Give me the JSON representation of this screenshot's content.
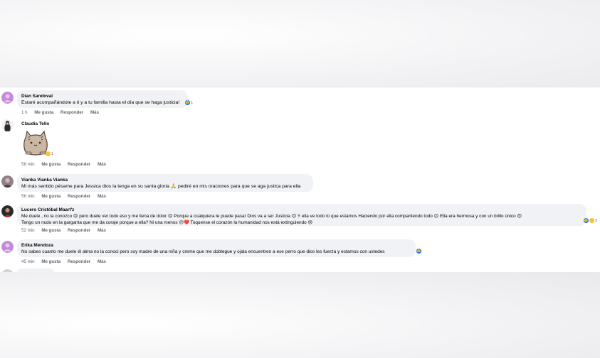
{
  "comments": [
    {
      "author": "Dian Sandoval",
      "text": "Estaré acompañándote a ti y a tu familia hasta el día que se haga justicia!",
      "time": "1 h",
      "like": "Me gusta",
      "reply": "Responder",
      "more": "Más",
      "reaction_count": "1",
      "avatar_color": "#c58ad6"
    },
    {
      "author": "Claudia Tello",
      "time": "58 min",
      "like": "Me gusta",
      "reply": "Responder",
      "more": "Más",
      "reaction_count": "1",
      "sticker": "pusheen-cat-sticker"
    },
    {
      "author": "Vianka Vianka Vianka",
      "text": "Mi más sentido pésame para Jessica dios la tenga en su santa gloria 🙏 pediré en mis oraciones para que se aga justica para ella",
      "time": "56 min",
      "like": "Me gusta",
      "reply": "Responder",
      "more": "Más"
    },
    {
      "author": "Lucero Cristóbal Maart'z",
      "text_line1": "Me duele , no la conozco 😣 pero duele ver todo eso y me llena de dolor 😔 Porque a cualquiera le puede pasar Dios va a ser Justicia 😊 Y ella ve todo lo que estamos Haciendo por ella compartiendo todo 😉 Ella era hermosa y con un brillo único 😍",
      "text_line2": "Tengo un nudo en la garganta que me da coraje porque a ella? Ni una menos 😔❤️ Toquense el corazón la humanidad nos está extinguiendo 😢",
      "time": "52 min",
      "like": "Me gusta",
      "reply": "Responder",
      "more": "Más",
      "reaction_count": "2"
    },
    {
      "author": "Erika Mendoza",
      "text": "No sabes cuanto me duele él alma no la conoci pero soy madre de una niña y creme que me doblegue y ojala encuentren a ese perro que dios les fuerza y estamos con ustedes",
      "time": "45 min",
      "like": "Me gusta",
      "reply": "Responder",
      "more": "Más",
      "avatar_color": "#c58ad6"
    }
  ],
  "colors": {
    "bubble": "#f0f2f5",
    "meta_text": "#65676b",
    "like_blue": "#1877f2"
  }
}
